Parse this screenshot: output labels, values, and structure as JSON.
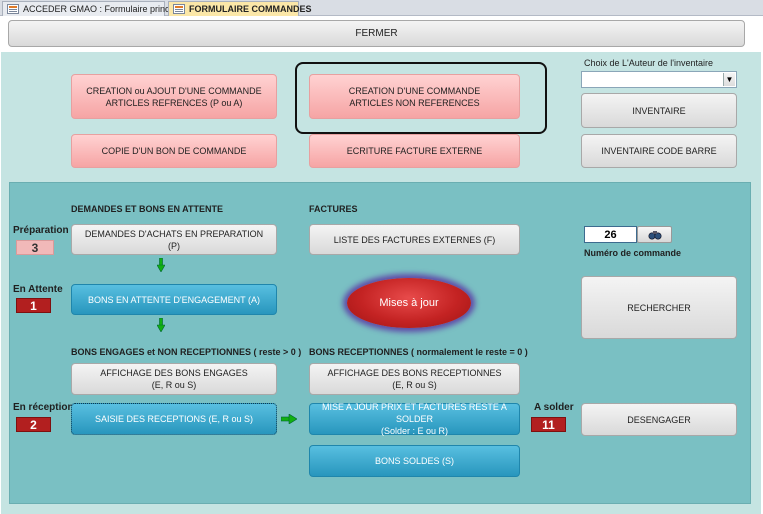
{
  "tabs": [
    {
      "label": "ACCEDER GMAO : Formulaire principal",
      "active": false
    },
    {
      "label": "FORMULAIRE COMMANDES",
      "active": true
    }
  ],
  "header": {
    "close_label": "FERMER"
  },
  "top_buttons": {
    "creation_referenced": "CREATION ou AJOUT D'UNE  COMMANDE\nARTICLES REFRENCES (P ou A)",
    "creation_unreferenced": "CREATION D'UNE COMMANDE\nARTICLES NON REFERENCES",
    "copy_order": "COPIE D'UN BON DE COMMANDE",
    "external_invoice": "ECRITURE FACTURE EXTERNE"
  },
  "inventory": {
    "author_label": "Choix de L'Auteur de l'inventaire",
    "author_value": "",
    "inventory_button": "INVENTAIRE",
    "barcode_button": "INVENTAIRE CODE BARRE"
  },
  "pending": {
    "section_title": "DEMANDES ET BONS EN ATTENTE",
    "preparation_label": "Préparation",
    "preparation_count": "3",
    "requests_button": "DEMANDES D'ACHATS EN PREPARATION (P)",
    "waiting_label": "En Attente",
    "waiting_count": "1",
    "waiting_button": "BONS EN ATTENTE D'ENGAGEMENT (A)"
  },
  "invoices": {
    "section_title": "FACTURES",
    "list_button": "LISTE DES FACTURES EXTERNES (F)",
    "update_button": "Mises à jour"
  },
  "order_search": {
    "order_number": "26",
    "order_number_label": "Numéro de commande",
    "search_button": "RECHERCHER"
  },
  "engaged": {
    "section_title": "BONS ENGAGES et NON RECEPTIONNES ( reste > 0 )",
    "display_button": "AFFICHAGE DES BONS ENGAGES\n(E, R ou S)",
    "reception_label": "En réception",
    "reception_count": "2",
    "entry_button": "SAISIE DES RECEPTIONS (E, R ou S)"
  },
  "received": {
    "section_title": "BONS RECEPTIONNES ( normalement le reste = 0 )",
    "display_button": "AFFICHAGE DES BONS RECEPTIONNES\n(E, R ou S)",
    "update_button": "MISE A JOUR PRIX ET FACTURES RESTE A SOLDER\n(Solder : E ou R)",
    "settle_label": "A solder",
    "settle_count": "11",
    "settled_button": "BONS SOLDES (S)",
    "disengage_button": "DESENGAGER"
  },
  "colors": {
    "background": "#c5e4e2",
    "panel": "#7ac0c3",
    "pink_button": "#f6a4a4",
    "blue_button": "#2896bd",
    "red_badge": "#b21f1f",
    "arrow_green": "#12b012"
  }
}
